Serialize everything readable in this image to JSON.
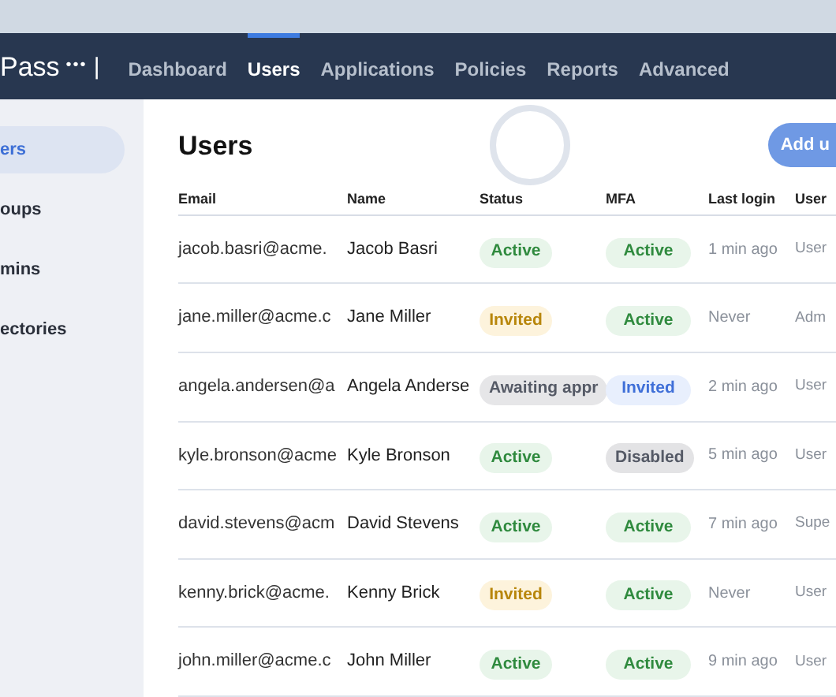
{
  "brand": {
    "name": "Pass",
    "dots": "•••",
    "separator": "|"
  },
  "nav": [
    {
      "label": "Dashboard",
      "selected": false
    },
    {
      "label": "Users",
      "selected": true
    },
    {
      "label": "Applications",
      "selected": false
    },
    {
      "label": "Policies",
      "selected": false
    },
    {
      "label": "Reports",
      "selected": false
    },
    {
      "label": "Advanced",
      "selected": false
    }
  ],
  "sidebar": {
    "items": [
      {
        "label": "ers",
        "selected": true
      },
      {
        "label": "oups",
        "selected": false
      },
      {
        "label": "mins",
        "selected": false
      },
      {
        "label": "ectories",
        "selected": false
      }
    ]
  },
  "page": {
    "title": "Users",
    "add_button": "Add u"
  },
  "table": {
    "columns": [
      "Email",
      "Name",
      "Status",
      "MFA",
      "Last login",
      "User"
    ],
    "rows": [
      {
        "email": "jacob.basri@acme.",
        "name": "Jacob Basri",
        "status": {
          "label": "Active",
          "kind": "active"
        },
        "mfa": {
          "label": "Active",
          "kind": "active"
        },
        "last_login": "1 min ago",
        "role": "User"
      },
      {
        "email": "jane.miller@acme.c",
        "name": "Jane Miller",
        "status": {
          "label": "Invited",
          "kind": "invited"
        },
        "mfa": {
          "label": "Active",
          "kind": "active"
        },
        "last_login": "Never",
        "role": "Adm"
      },
      {
        "email": "angela.andersen@a",
        "name": "Angela Anderse",
        "status": {
          "label": "Awaiting appr",
          "kind": "awaiting"
        },
        "mfa": {
          "label": "Invited",
          "kind": "pending"
        },
        "last_login": "2 min ago",
        "role": "User"
      },
      {
        "email": "kyle.bronson@acme",
        "name": "Kyle Bronson",
        "status": {
          "label": "Active",
          "kind": "active"
        },
        "mfa": {
          "label": "Disabled",
          "kind": "disabled"
        },
        "last_login": "5 min ago",
        "role": "User"
      },
      {
        "email": "david.stevens@acm",
        "name": "David Stevens",
        "status": {
          "label": "Active",
          "kind": "active"
        },
        "mfa": {
          "label": "Active",
          "kind": "active"
        },
        "last_login": "7 min ago",
        "role": "Supe"
      },
      {
        "email": "kenny.brick@acme.",
        "name": "Kenny Brick",
        "status": {
          "label": "Invited",
          "kind": "invited"
        },
        "mfa": {
          "label": "Active",
          "kind": "active"
        },
        "last_login": "Never",
        "role": "User"
      },
      {
        "email": "john.miller@acme.c",
        "name": "John Miller",
        "status": {
          "label": "Active",
          "kind": "active"
        },
        "mfa": {
          "label": "Active",
          "kind": "active"
        },
        "last_login": "9 min ago",
        "role": "User"
      }
    ]
  }
}
